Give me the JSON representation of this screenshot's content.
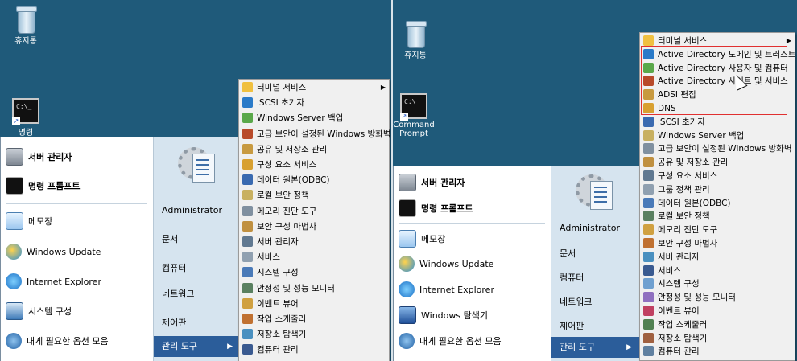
{
  "desktop_left": {
    "recycle_bin_label": "휴지통",
    "cmd_label": "명령"
  },
  "desktop_right": {
    "recycle_bin_label": "휴지통",
    "cmd_label_line1": "Command",
    "cmd_label_line2": "Prompt"
  },
  "start_menu_left": {
    "pinned": [
      "서버 관리자",
      "명령 프롬프트"
    ],
    "recent": [
      "메모장",
      "Windows Update",
      "Internet Explorer",
      "시스템 구성",
      "내게 필요한 옵션 모음"
    ],
    "right": [
      "Administrator",
      "문서",
      "컴퓨터",
      "네트워크",
      "제어판",
      "관리 도구"
    ]
  },
  "start_menu_right": {
    "pinned": [
      "서버 관리자",
      "명령 프롬프트"
    ],
    "recent": [
      "메모장",
      "Windows Update",
      "Internet Explorer",
      "Windows 탐색기",
      "내게 필요한 옵션 모음"
    ],
    "right": [
      "Administrator",
      "문서",
      "컴퓨터",
      "네트워크",
      "제어판",
      "관리 도구"
    ]
  },
  "submenu_left": [
    "터미널 서비스",
    "iSCSI 초기자",
    "Windows Server 백업",
    "고급 보안이 설정된 Windows 방화벽",
    "공유 및 저장소 관리",
    "구성 요소 서비스",
    "데이터 원본(ODBC)",
    "로컬 보안 정책",
    "메모리 진단 도구",
    "보안 구성 마법사",
    "서버 관리자",
    "서비스",
    "시스템 구성",
    "안정성 및 성능 모니터",
    "이벤트 뷰어",
    "작업 스케줄러",
    "저장소 탐색기",
    "컴퓨터 관리"
  ],
  "submenu_right": [
    "터미널 서비스",
    "Active Directory 도메인 및 트러스트",
    "Active Directory 사용자 및 컴퓨터",
    "Active Directory 사이트 및 서비스",
    "ADSI 편집",
    "DNS",
    "iSCSI 초기자",
    "Windows Server 백업",
    "고급 보안이 설정된 Windows 방화벽",
    "공유 및 저장소 관리",
    "구성 요소 서비스",
    "그룹 정책 관리",
    "데이터 원본(ODBC)",
    "로컬 보안 정책",
    "메모리 진단 도구",
    "보안 구성 마법사",
    "서버 관리자",
    "서비스",
    "시스템 구성",
    "안정성 및 성능 모니터",
    "이벤트 뷰어",
    "작업 스케줄러",
    "저장소 탐색기",
    "컴퓨터 관리"
  ],
  "icons": {
    "submenu_left": [
      "folder-icon",
      "globe-icon",
      "backup-icon",
      "firewall-icon",
      "share-icon",
      "component-icon",
      "database-icon",
      "policy-icon",
      "memory-icon",
      "security-wizard-icon",
      "server-manager-icon",
      "services-icon",
      "system-config-icon",
      "monitor-icon",
      "event-viewer-icon",
      "scheduler-icon",
      "storage-icon",
      "computer-management-icon"
    ]
  },
  "colors": {
    "desktop": "#1f5a7a",
    "menu_highlight": "#2b5d9a",
    "annotation_box": "#e03030"
  }
}
